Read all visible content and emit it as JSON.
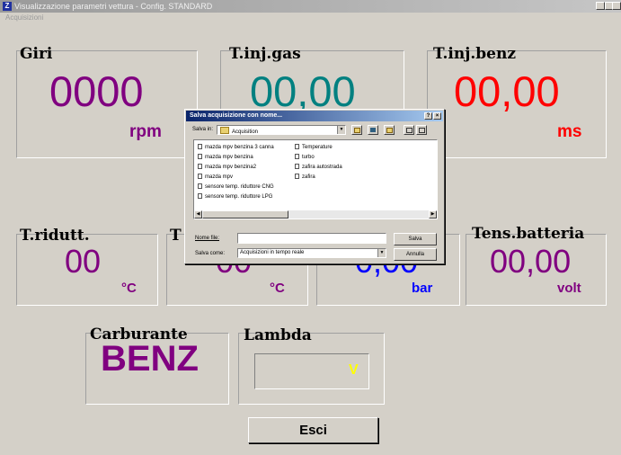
{
  "window": {
    "title": "Visualizzazione parametri vettura - Config. STANDARD",
    "menu": "Acquisizioni"
  },
  "gauges": {
    "giri": {
      "label": "Giri",
      "value": "0000",
      "unit": "rpm",
      "color": "#800080"
    },
    "tinj_gas": {
      "label": "T.inj.gas",
      "value": "00,00",
      "color": "#008080"
    },
    "tinj_benz": {
      "label": "T.inj.benz",
      "value": "00,00",
      "unit": "ms",
      "color": "#ff0000"
    },
    "tridutt": {
      "label": "T.ridutt.",
      "value": "00",
      "unit": "°C",
      "color": "#800080"
    },
    "t_gas": {
      "label": "T",
      "value": "00",
      "unit": "°C",
      "color": "#800080"
    },
    "pressione": {
      "value": "0,00",
      "unit": "bar",
      "color": "#0000ff"
    },
    "tens_batteria": {
      "label": "Tens.batteria",
      "value": "00,00",
      "unit": "volt",
      "color": "#800080"
    },
    "carburante": {
      "label": "Carburante",
      "value": "BENZ",
      "color": "#800080"
    },
    "lambda": {
      "label": "Lambda",
      "value": "V",
      "color": "#ffff00"
    }
  },
  "buttons": {
    "esci": "Esci"
  },
  "dialog": {
    "title": "Salva acquisizione con nome...",
    "save_in_label": "Salva in:",
    "save_in_value": "Acquisition",
    "files_col1": [
      "mazda mpv benzina 3 canna",
      "mazda mpv benzina",
      "mazda mpv benzina2",
      "mazda mpv",
      "sensore temp. riduttore CNG",
      "sensore temp. riduttore LPG"
    ],
    "files_col2": [
      "Temperature",
      "turbo",
      "zafira autostrada",
      "zafira"
    ],
    "filename_label": "Nome file:",
    "filename_value": "",
    "saveas_label": "Salva come:",
    "saveas_value": "Acquisizioni in tempo reale",
    "save_button": "Salva",
    "cancel_button": "Annulla",
    "help_glyph": "?",
    "close_glyph": "×"
  }
}
